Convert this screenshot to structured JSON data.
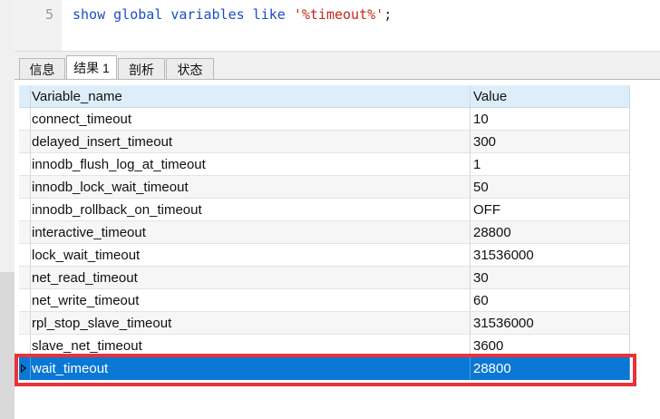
{
  "editor": {
    "line_number": "5",
    "sql": {
      "kw1": "show global variables like",
      "literal": "'%timeout%'",
      "terminator": ";"
    }
  },
  "tabs": [
    {
      "label": "信息",
      "active": false
    },
    {
      "label": "结果 1",
      "active": true
    },
    {
      "label": "剖析",
      "active": false
    },
    {
      "label": "状态",
      "active": false
    }
  ],
  "grid": {
    "columns": [
      "Variable_name",
      "Value"
    ],
    "rows": [
      [
        "connect_timeout",
        "10"
      ],
      [
        "delayed_insert_timeout",
        "300"
      ],
      [
        "innodb_flush_log_at_timeout",
        "1"
      ],
      [
        "innodb_lock_wait_timeout",
        "50"
      ],
      [
        "innodb_rollback_on_timeout",
        "OFF"
      ],
      [
        "interactive_timeout",
        "28800"
      ],
      [
        "lock_wait_timeout",
        "31536000"
      ],
      [
        "net_read_timeout",
        "30"
      ],
      [
        "net_write_timeout",
        "60"
      ],
      [
        "rpl_stop_slave_timeout",
        "31536000"
      ],
      [
        "slave_net_timeout",
        "3600"
      ],
      [
        "wait_timeout",
        "28800"
      ]
    ],
    "selected_row": 11
  },
  "colors": {
    "selection": "#0a78d4",
    "highlight_box": "#e8323c",
    "header": "#ddeefa",
    "keyword": "#1a4fc4",
    "string": "#c1281a"
  }
}
